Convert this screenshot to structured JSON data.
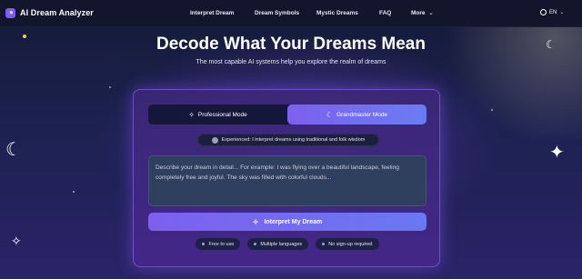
{
  "header": {
    "brand": "AI Dream Analyzer",
    "nav": [
      "Interpret Dream",
      "Dream Symbols",
      "Mystic Dreams",
      "FAQ"
    ],
    "more_label": "More",
    "lang_label": "EN"
  },
  "hero": {
    "title": "Decode What Your Dreams Mean",
    "subtitle": "The most capable AI systems help you explore the realm of dreams"
  },
  "card": {
    "modes": [
      "Professional Mode",
      "Grandmaster Mode"
    ],
    "active_mode": "Grandmaster Mode",
    "experience_badge": "Experienced: I interpret dreams using traditional and folk wisdom",
    "input_placeholder": "Describe your dream in detail... For example: I was flying over a beautiful landscape, feeling completely free and joyful. The sky was filled with colorful clouds...",
    "submit_label": "Interpret My Dream",
    "features": [
      "Free to use",
      "Multiple languages",
      "No sign-up required"
    ]
  },
  "icons": {
    "logo": "moon-logo-icon",
    "lang": "globe-icon",
    "more": "chevron-down-icon",
    "professional": "sparkle-icon",
    "grandmaster": "moon-icon",
    "experience": "clock-icon",
    "submit": "sparkle-icon",
    "decor_left": "moon-icon",
    "decor_right": "sparkle-icon"
  },
  "colors": {
    "accent": "#7d60ee",
    "nav_bg": "#12152c",
    "card_border": "#9670ff"
  }
}
